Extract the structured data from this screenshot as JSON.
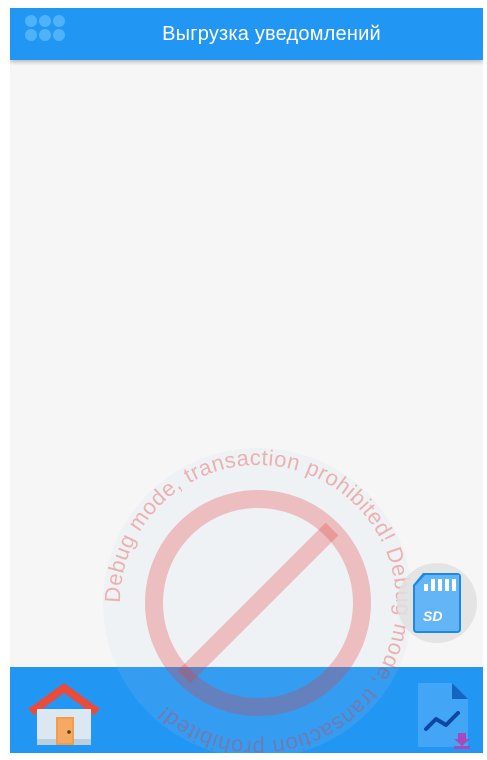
{
  "header": {
    "title": "Выгрузка уведомлений",
    "menu_icon": "grid-menu-icon"
  },
  "watermark": {
    "text": "Debug mode, transaction prohibited! Debug mode, transaction prohibited!",
    "icon": "prohibited-icon"
  },
  "fab": {
    "icon": "sd-card-icon",
    "card_label": "SD"
  },
  "bottom_nav": {
    "home_icon": "home-icon",
    "report_icon": "report-download-icon"
  },
  "colors": {
    "primary": "#2196f3",
    "background": "#f6f6f6",
    "watermark": "#e53935"
  }
}
